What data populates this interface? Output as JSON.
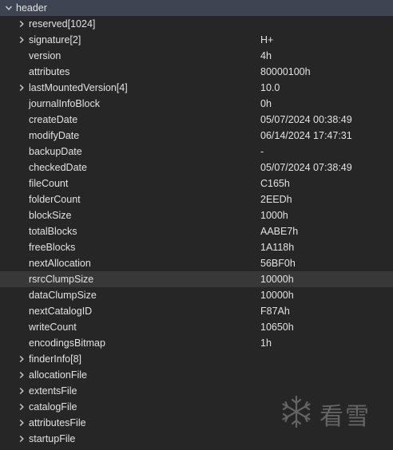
{
  "tree": {
    "root": {
      "label": "header"
    },
    "rows": [
      {
        "name": "reserved[1024]",
        "value": "",
        "expandable": true
      },
      {
        "name": "signature[2]",
        "value": "H+",
        "expandable": true
      },
      {
        "name": "version",
        "value": "4h",
        "expandable": false
      },
      {
        "name": "attributes",
        "value": "80000100h",
        "expandable": false
      },
      {
        "name": "lastMountedVersion[4]",
        "value": "10.0",
        "expandable": true
      },
      {
        "name": "journalInfoBlock",
        "value": "0h",
        "expandable": false
      },
      {
        "name": "createDate",
        "value": "05/07/2024 00:38:49",
        "expandable": false
      },
      {
        "name": "modifyDate",
        "value": "06/14/2024 17:47:31",
        "expandable": false
      },
      {
        "name": "backupDate",
        "value": "-",
        "expandable": false
      },
      {
        "name": "checkedDate",
        "value": "05/07/2024 07:38:49",
        "expandable": false
      },
      {
        "name": "fileCount",
        "value": "C165h",
        "expandable": false
      },
      {
        "name": "folderCount",
        "value": "2EEDh",
        "expandable": false
      },
      {
        "name": "blockSize",
        "value": "1000h",
        "expandable": false
      },
      {
        "name": "totalBlocks",
        "value": "AABE7h",
        "expandable": false
      },
      {
        "name": "freeBlocks",
        "value": "1A118h",
        "expandable": false
      },
      {
        "name": "nextAllocation",
        "value": "56BF0h",
        "expandable": false
      },
      {
        "name": "rsrcClumpSize",
        "value": "10000h",
        "expandable": false,
        "selected": true
      },
      {
        "name": "dataClumpSize",
        "value": "10000h",
        "expandable": false
      },
      {
        "name": "nextCatalogID",
        "value": "F87Ah",
        "expandable": false
      },
      {
        "name": "writeCount",
        "value": "10650h",
        "expandable": false
      },
      {
        "name": "encodingsBitmap",
        "value": "1h",
        "expandable": false
      },
      {
        "name": "finderInfo[8]",
        "value": "",
        "expandable": true
      },
      {
        "name": "allocationFile",
        "value": "",
        "expandable": true
      },
      {
        "name": "extentsFile",
        "value": "",
        "expandable": true
      },
      {
        "name": "catalogFile",
        "value": "",
        "expandable": true
      },
      {
        "name": "attributesFile",
        "value": "",
        "expandable": true
      },
      {
        "name": "startupFile",
        "value": "",
        "expandable": true
      }
    ]
  },
  "watermark": {
    "text": "看雪",
    "icon": "snowflake-icon"
  },
  "colors": {
    "background": "#262626",
    "root_row": "#3e4452",
    "selected_row": "#383838",
    "text": "#e2e2e2"
  }
}
